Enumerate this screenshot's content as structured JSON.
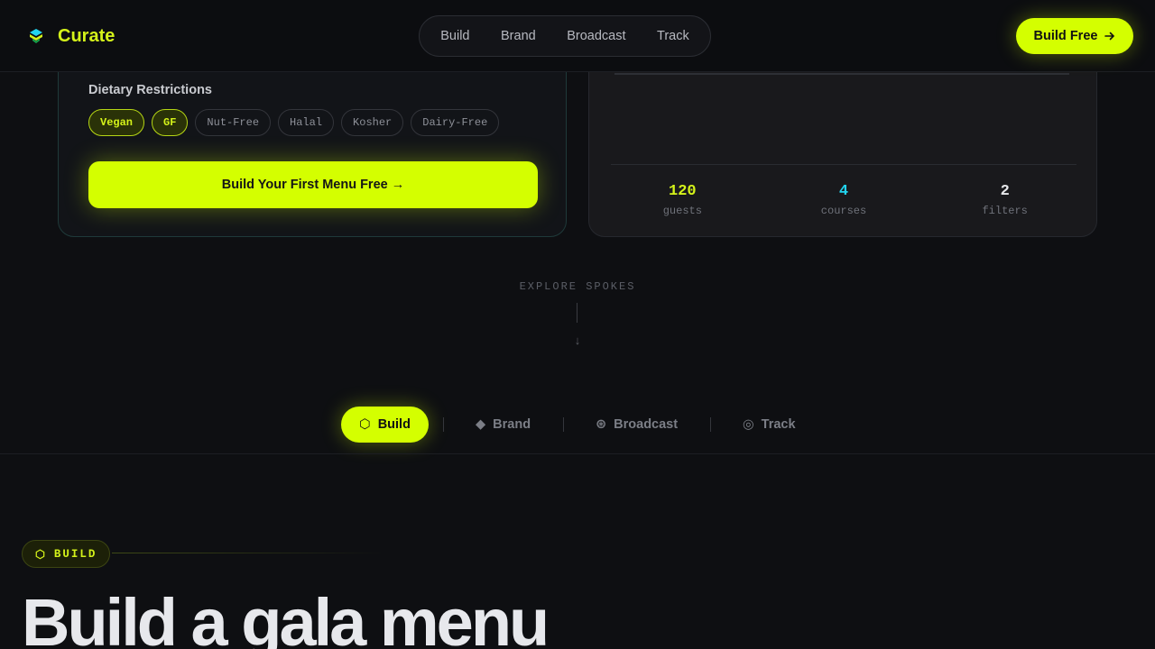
{
  "header": {
    "brand": "Curate",
    "nav": [
      "Build",
      "Brand",
      "Broadcast",
      "Track"
    ],
    "cta_label": "Build Free",
    "cta_icon": "arrow-right-icon"
  },
  "builder": {
    "dietary_title": "Dietary Restrictions",
    "chips": [
      {
        "label": "Vegan",
        "active": true
      },
      {
        "label": "GF",
        "active": true
      },
      {
        "label": "Nut-Free",
        "active": false
      },
      {
        "label": "Halal",
        "active": false
      },
      {
        "label": "Kosher",
        "active": false
      },
      {
        "label": "Dairy-Free",
        "active": false
      }
    ],
    "cta_label": "Build Your First Menu Free →"
  },
  "preview": {
    "stats": [
      {
        "value": "120",
        "label": "guests",
        "color": "#d4f21a"
      },
      {
        "value": "4",
        "label": "courses",
        "color": "#22d3ee"
      },
      {
        "value": "2",
        "label": "filters",
        "color": "#e6e7ea"
      }
    ]
  },
  "explore": {
    "label": "EXPLORE SPOKES",
    "arrow": "↓"
  },
  "spokes": {
    "tabs": [
      {
        "icon": "⬡",
        "icon_name": "hexagon-icon",
        "label": "Build"
      },
      {
        "icon": "◆",
        "icon_name": "diamond-icon",
        "label": "Brand"
      },
      {
        "icon": "⊛",
        "icon_name": "broadcast-icon",
        "label": "Broadcast"
      },
      {
        "icon": "◎",
        "icon_name": "target-icon",
        "label": "Track"
      }
    ]
  },
  "section": {
    "badge_icon": "⬡",
    "badge_label": "BUILD",
    "headline": "Build a gala menu"
  },
  "colors": {
    "accent": "#d4ff00",
    "cyan": "#22d3ee",
    "background": "#0e0f12"
  }
}
